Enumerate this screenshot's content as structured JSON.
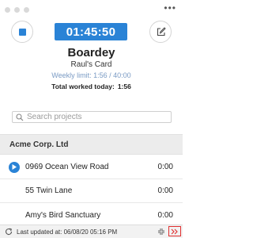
{
  "header": {
    "timer": "01:45:50",
    "more_label": "•••"
  },
  "summary": {
    "organization": "Boardey",
    "card": "Raul's Card",
    "weekly_limit": "Weekly limit: 1:56 / 40:00",
    "total_label": "Total worked today:",
    "total_value": "1:56"
  },
  "search": {
    "placeholder": "Search projects"
  },
  "projects": {
    "group_name": "Acme Corp. Ltd",
    "tasks": [
      {
        "name": "0969 Ocean View Road",
        "time": "0:00",
        "active": true
      },
      {
        "name": "55 Twin Lane",
        "time": "0:00",
        "active": false
      },
      {
        "name": "Amy's Bird Sanctuary",
        "time": "0:00",
        "active": false
      }
    ]
  },
  "footer": {
    "last_updated": "Last updated at: 06/08/20 05:16 PM"
  },
  "colors": {
    "accent": "#2a83d6",
    "highlight_border": "#e03030"
  },
  "icons": {
    "stop": "stop-icon",
    "edit": "edit-icon",
    "search": "search-icon",
    "play": "play-icon",
    "refresh": "refresh-icon",
    "compress": "compress-icon",
    "expand": "expand-icon"
  }
}
